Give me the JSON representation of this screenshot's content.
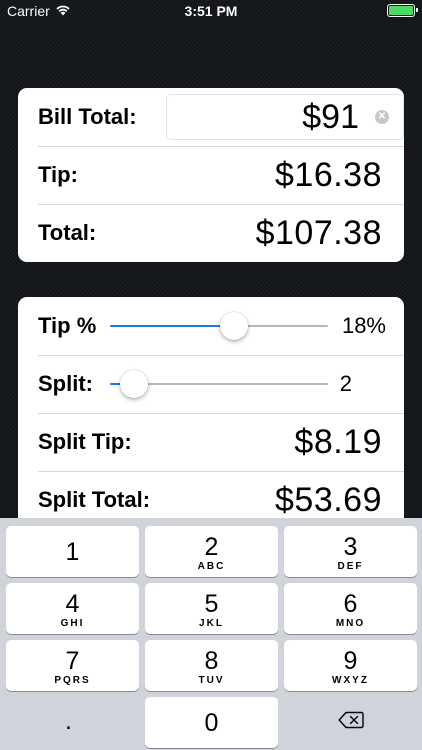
{
  "status_bar": {
    "carrier": "Carrier",
    "time": "3:51 PM"
  },
  "summary": {
    "bill_total_label": "Bill Total:",
    "bill_total_value": "$91",
    "tip_label": "Tip:",
    "tip_value": "$16.38",
    "total_label": "Total:",
    "total_value": "$107.38"
  },
  "controls": {
    "tip_percent_label": "Tip %",
    "tip_percent_value": "18%",
    "tip_slider_fraction": 0.58,
    "split_label": "Split:",
    "split_value": "2",
    "split_slider_fraction": 0.05,
    "split_tip_label": "Split Tip:",
    "split_tip_value": "$8.19",
    "split_total_label": "Split Total:",
    "split_total_value": "$53.69"
  },
  "keypad": {
    "keys": [
      {
        "num": "1",
        "letters": ""
      },
      {
        "num": "2",
        "letters": "ABC"
      },
      {
        "num": "3",
        "letters": "DEF"
      },
      {
        "num": "4",
        "letters": "GHI"
      },
      {
        "num": "5",
        "letters": "JKL"
      },
      {
        "num": "6",
        "letters": "MNO"
      },
      {
        "num": "7",
        "letters": "PQRS"
      },
      {
        "num": "8",
        "letters": "TUV"
      },
      {
        "num": "9",
        "letters": "WXYZ"
      }
    ],
    "dot": ".",
    "zero": "0"
  },
  "colors": {
    "accent": "#1a7ae6",
    "battery": "#4cd964"
  }
}
